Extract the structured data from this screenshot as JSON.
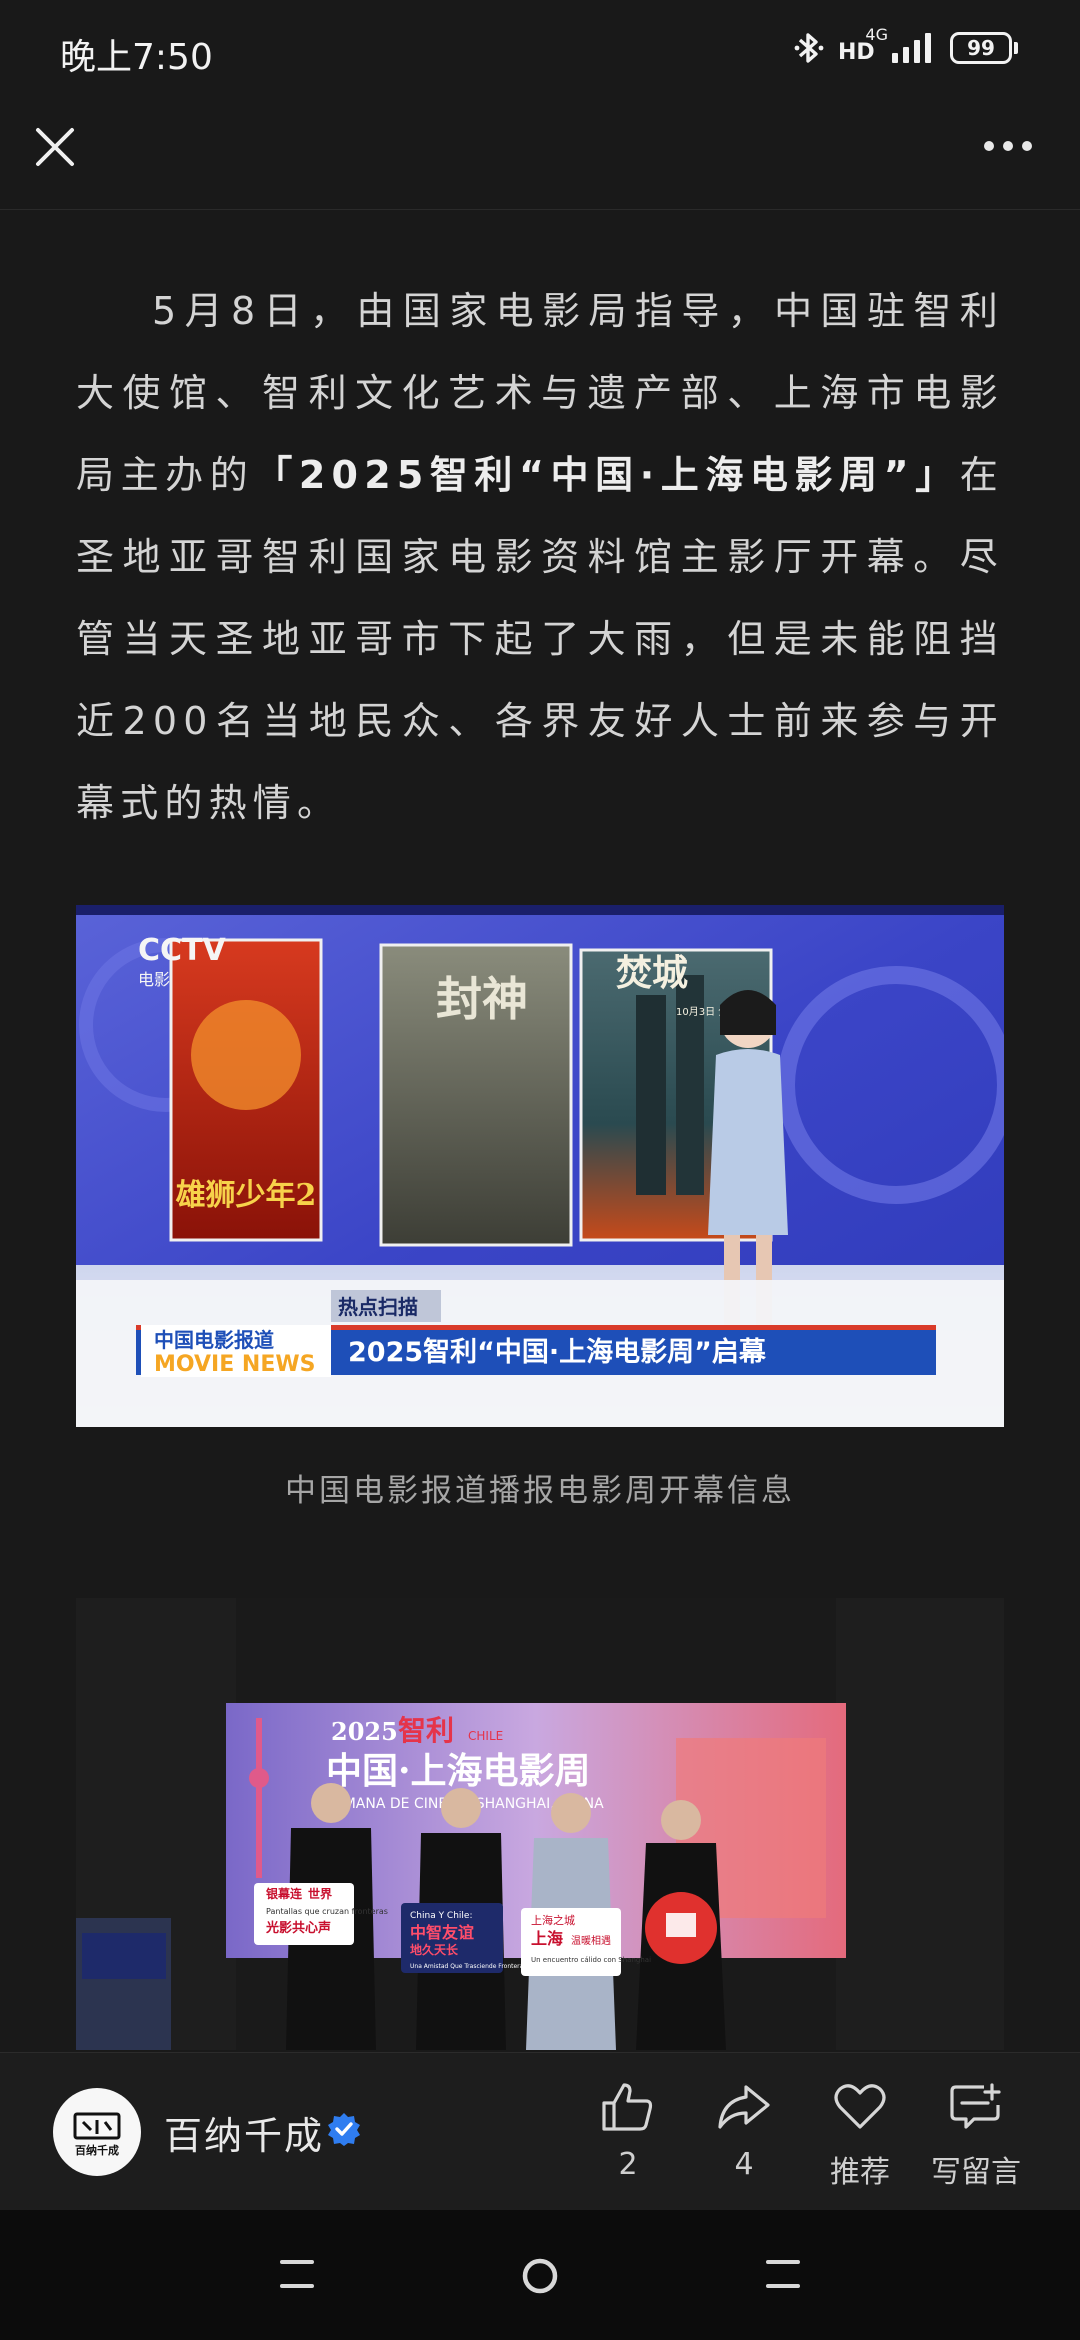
{
  "status_bar": {
    "time": "晚上7:50",
    "network_type": "4G",
    "hd_label": "HD",
    "battery_level": "99",
    "icons": [
      "bluetooth-icon",
      "hd-icon",
      "signal-icon",
      "battery-icon"
    ]
  },
  "nav": {
    "close_icon": "close-icon",
    "more_icon": "more-icon"
  },
  "article": {
    "para1_before": "5月8日，由国家电影局指导，中国驻智利大使馆、智利文化艺术与遗产部、上海市电影局主办的",
    "para1_bold": "「2025智利“中国·上海电影周”」",
    "para1_after": "在圣地亚哥智利国家电影资料馆主影厅开幕。尽管当天圣地亚哥市下起了大雨，但是未能阻挡近200名当地民众、各界友好人士前来参与开幕式的热情。",
    "figure1": {
      "channel_logo": "CCTV",
      "channel_sub": "电影",
      "posters": [
        {
          "title": "雄狮少年2"
        },
        {
          "title": "封神"
        },
        {
          "title": "焚城",
          "subtitle": "10月3日  全国上映"
        }
      ],
      "news_tag": "热点扫描",
      "show_name_cn": "中国电影报道",
      "show_name_en": "MOVIE NEWS",
      "headline": "2025智利“中国·上海电影周”启幕",
      "caption": "中国电影报道播报电影周开幕信息"
    },
    "figure2": {
      "backdrop_year": "2025",
      "backdrop_country_cn": "智利",
      "backdrop_country_en": "CHILE",
      "backdrop_title": "中国·上海电影周",
      "backdrop_subtitle": "SEMANA DE CINE DE SHANGHAI, CHINA",
      "signs": [
        {
          "line1": "银幕连",
          "line2": "世界",
          "line3": "光影共心声",
          "es": "Pantallas que cruzan fronteras"
        },
        {
          "line1": "China Y Chile:",
          "line2": "中智友谊",
          "line3": "地久天长",
          "es": "Una Amistad Que Trasciende Fronteras"
        },
        {
          "line1": "上海之城",
          "line2": "上海",
          "line3": "温暖相遇",
          "es": "Un encuentro cálido con Shanghai"
        },
        {
          "line1": "",
          "line2": "",
          "line3": "",
          "es": ""
        }
      ]
    }
  },
  "author": {
    "name": "百纳千成",
    "avatar_text": "百纳千成",
    "verified_icon": "verified-badge-icon"
  },
  "actions": [
    {
      "icon": "thumbs-up-icon",
      "label": "2"
    },
    {
      "icon": "share-icon",
      "label": "4"
    },
    {
      "icon": "heart-icon",
      "label": "推荐"
    },
    {
      "icon": "comment-icon",
      "label": "写留言"
    }
  ],
  "colors": {
    "background": "#191919",
    "text": "#d4d4d4",
    "accent_blue": "#2f6fe8",
    "news_blue": "#1e4fb8"
  }
}
